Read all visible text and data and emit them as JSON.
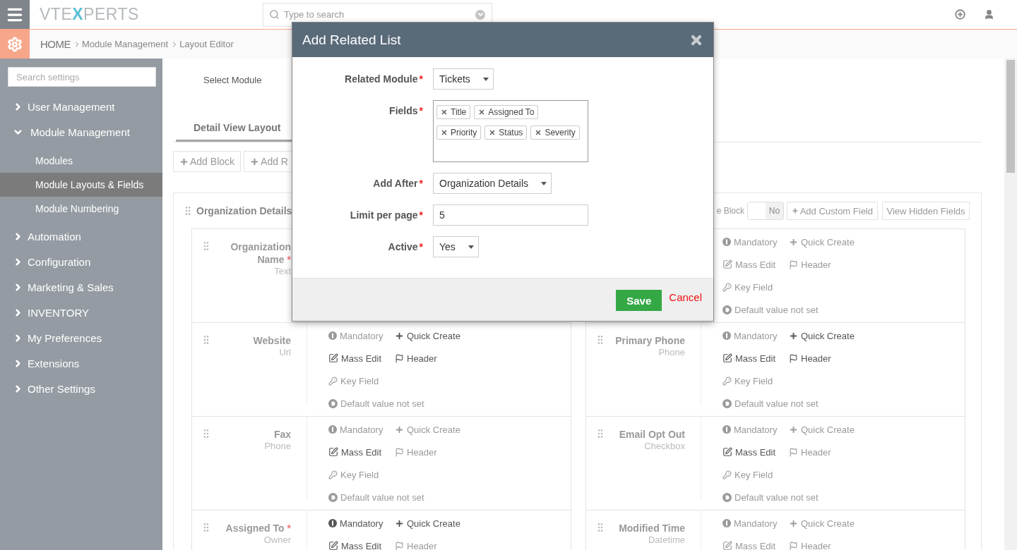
{
  "topbar": {
    "logo": "VTEXPERTS",
    "search_placeholder": "Type to search"
  },
  "breadcrumb": {
    "home": "HOME",
    "items": [
      "Module Management",
      "Layout Editor"
    ]
  },
  "sidebar": {
    "search_placeholder": "Search settings",
    "items": [
      {
        "label": "User Management",
        "expanded": false
      },
      {
        "label": "Module Management",
        "expanded": true,
        "children": [
          {
            "label": "Modules",
            "selected": false
          },
          {
            "label": "Module Layouts & Fields",
            "selected": true
          },
          {
            "label": "Module Numbering",
            "selected": false
          }
        ]
      },
      {
        "label": "Automation",
        "expanded": false
      },
      {
        "label": "Configuration",
        "expanded": false
      },
      {
        "label": "Marketing & Sales",
        "expanded": false
      },
      {
        "label": "INVENTORY",
        "expanded": false
      },
      {
        "label": "My Preferences",
        "expanded": false
      },
      {
        "label": "Extensions",
        "expanded": false
      },
      {
        "label": "Other Settings",
        "expanded": false
      }
    ]
  },
  "main": {
    "select_module_label": "Select Module",
    "tabs": [
      {
        "label": "Detail View Layout",
        "selected": true
      }
    ],
    "actions": [
      {
        "label": "Add Block"
      },
      {
        "label": "Add R"
      }
    ],
    "block": {
      "title": "Organization Details",
      "hide_block_label": "e Block",
      "toggle": {
        "label": "No",
        "on": false
      },
      "buttons": [
        "Add Custom Field",
        "View Hidden Fields"
      ],
      "cards": [
        {
          "name": "Organization",
          "name_line2": "Name",
          "mark": "*",
          "type": "Text"
        },
        {
          "options": [
            {
              "kind": "mandatory",
              "label": "Mandatory",
              "on": false
            },
            {
              "kind": "quick_create",
              "label": "Quick Create",
              "on": false
            },
            {
              "kind": "mass_edit",
              "label": "Mass Edit",
              "on": false
            },
            {
              "kind": "header",
              "label": "Header",
              "on": false
            },
            {
              "kind": "key_field",
              "label": "Key Field",
              "on": false
            },
            {
              "kind": "default",
              "label": "Default value not set",
              "on": false
            }
          ]
        },
        {
          "name": "Website",
          "type": "Url",
          "options": [
            {
              "kind": "mandatory",
              "label": "Mandatory",
              "on": false
            },
            {
              "kind": "quick_create",
              "label": "Quick Create",
              "on": true
            },
            {
              "kind": "mass_edit",
              "label": "Mass Edit",
              "on": true
            },
            {
              "kind": "header",
              "label": "Header",
              "on": true
            },
            {
              "kind": "key_field",
              "label": "Key Field",
              "on": false
            },
            {
              "kind": "default",
              "label": "Default value not set",
              "on": false
            }
          ]
        },
        {
          "name": "Primary Phone",
          "type": "Phone",
          "options": [
            {
              "kind": "mandatory",
              "label": "Mandatory",
              "on": false
            },
            {
              "kind": "quick_create",
              "label": "Quick Create",
              "on": true
            },
            {
              "kind": "mass_edit",
              "label": "Mass Edit",
              "on": true
            },
            {
              "kind": "header",
              "label": "Header",
              "on": true
            },
            {
              "kind": "key_field",
              "label": "Key Field",
              "on": false
            },
            {
              "kind": "default",
              "label": "Default value not set",
              "on": false
            }
          ]
        },
        {
          "name": "Fax",
          "type": "Phone",
          "options": [
            {
              "kind": "mandatory",
              "label": "Mandatory",
              "on": false
            },
            {
              "kind": "quick_create",
              "label": "Quick Create",
              "on": false
            },
            {
              "kind": "mass_edit",
              "label": "Mass Edit",
              "on": true
            },
            {
              "kind": "header",
              "label": "Header",
              "on": false
            },
            {
              "kind": "key_field",
              "label": "Key Field",
              "on": false
            },
            {
              "kind": "default",
              "label": "Default value not set",
              "on": false
            }
          ]
        },
        {
          "name": "Email Opt Out",
          "type": "Checkbox",
          "options": [
            {
              "kind": "mandatory",
              "label": "Mandatory",
              "on": false
            },
            {
              "kind": "quick_create",
              "label": "Quick Create",
              "on": false
            },
            {
              "kind": "mass_edit",
              "label": "Mass Edit",
              "on": true
            },
            {
              "kind": "header",
              "label": "Header",
              "on": false
            },
            {
              "kind": "key_field",
              "label": "Key Field",
              "on": false
            },
            {
              "kind": "default",
              "label": "Default value not set",
              "on": false
            }
          ]
        },
        {
          "name": "Assigned To",
          "mark": "*",
          "type": "Owner",
          "options": [
            {
              "kind": "mandatory",
              "label": "Mandatory",
              "on": true
            },
            {
              "kind": "quick_create",
              "label": "Quick Create",
              "on": true
            },
            {
              "kind": "mass_edit",
              "label": "Mass Edit",
              "on": true
            },
            {
              "kind": "header",
              "label": "Header",
              "on": false
            }
          ]
        },
        {
          "name": "Modified Time",
          "type": "Datetime",
          "options": [
            {
              "kind": "mandatory",
              "label": "Mandatory",
              "on": false
            },
            {
              "kind": "quick_create",
              "label": "Quick Create",
              "on": false
            },
            {
              "kind": "mass_edit",
              "label": "Mass Edit",
              "on": false
            },
            {
              "kind": "header",
              "label": "Header",
              "on": false
            }
          ]
        }
      ]
    }
  },
  "modal": {
    "title": "Add Related List",
    "fields": [
      {
        "kind": "select",
        "label": "Related Module",
        "mark": "*",
        "value": "Tickets"
      },
      {
        "kind": "tags",
        "label": "Fields",
        "mark": "*",
        "tags": [
          "Title",
          "Assigned To",
          "Priority",
          "Status",
          "Severity"
        ]
      },
      {
        "kind": "select",
        "label": "Add After",
        "mark": "*",
        "value": "Organization Details"
      },
      {
        "kind": "text",
        "label": "Limit per page",
        "mark": "*",
        "value": "5"
      },
      {
        "kind": "select",
        "label": "Active",
        "mark": "*",
        "value": "Yes"
      }
    ],
    "save": "Save",
    "cancel": "Cancel"
  }
}
